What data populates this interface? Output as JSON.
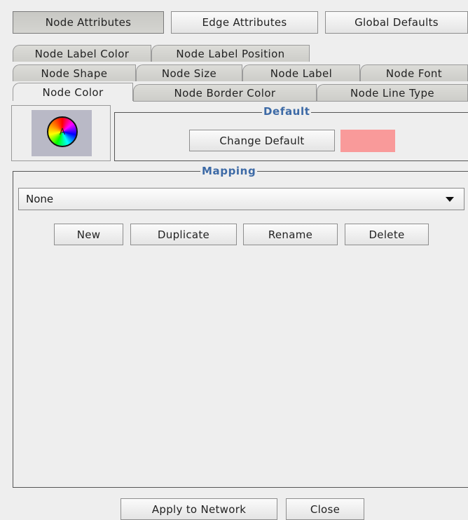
{
  "top_tabs": {
    "node_attributes": "Node Attributes",
    "edge_attributes": "Edge Attributes",
    "global_defaults": "Global Defaults"
  },
  "tab_rows": {
    "row1": [
      "Node Label Color",
      "Node Label Position"
    ],
    "row2": [
      "Node Shape",
      "Node Size",
      "Node Label",
      "Node Font"
    ],
    "row3": [
      "Node Color",
      "Node Border Color",
      "Node Line Type"
    ]
  },
  "default_section": {
    "legend": "Default",
    "change_button": "Change Default",
    "swatch_color": "#f99a9a",
    "icon_letter": "A"
  },
  "mapping_section": {
    "legend": "Mapping",
    "selected": "None",
    "buttons": {
      "new": "New",
      "duplicate": "Duplicate",
      "rename": "Rename",
      "delete": "Delete"
    }
  },
  "footer": {
    "apply": "Apply to Network",
    "close": "Close"
  }
}
